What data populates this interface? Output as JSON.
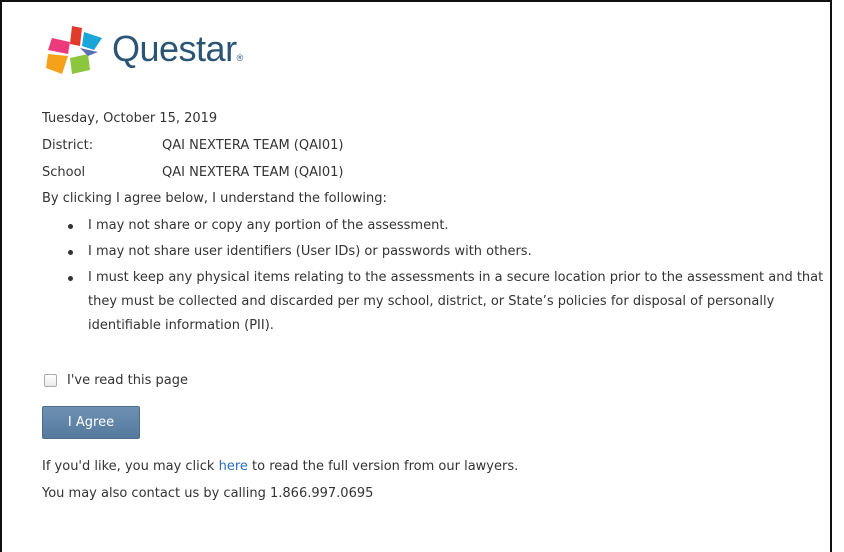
{
  "brand": {
    "name": "Questar"
  },
  "info": {
    "date": "Tuesday, October 15, 2019",
    "district_label": "District:",
    "district_value": "QAI NEXTERA TEAM (QAI01)",
    "school_label": "School",
    "school_value": "QAI NEXTERA TEAM (QAI01)"
  },
  "intro": "By clicking I agree below, I understand the following:",
  "bullets": [
    "I may not share or copy any portion of the assessment.",
    "I may not share user identifiers (User IDs) or passwords with others.",
    "I must keep any physical items relating to the assessments in a secure location prior to the assessment and that they must be collected and discarded per my school, district, or State’s policies for disposal of personally identifiable information (PII)."
  ],
  "checkbox": {
    "label": "I've read this page",
    "checked": false
  },
  "agree_button": {
    "label": "I Agree"
  },
  "footer": {
    "line1_before": "If you'd like, you may click",
    "line1_link": "here",
    "line1_after": "to read the full version from our lawyers.",
    "line2": "You may also contact us by calling 1.866.997.0695"
  },
  "colors": {
    "brand_text": "#2b5575",
    "button": "#5f84a8",
    "link": "#2a6ebb"
  }
}
